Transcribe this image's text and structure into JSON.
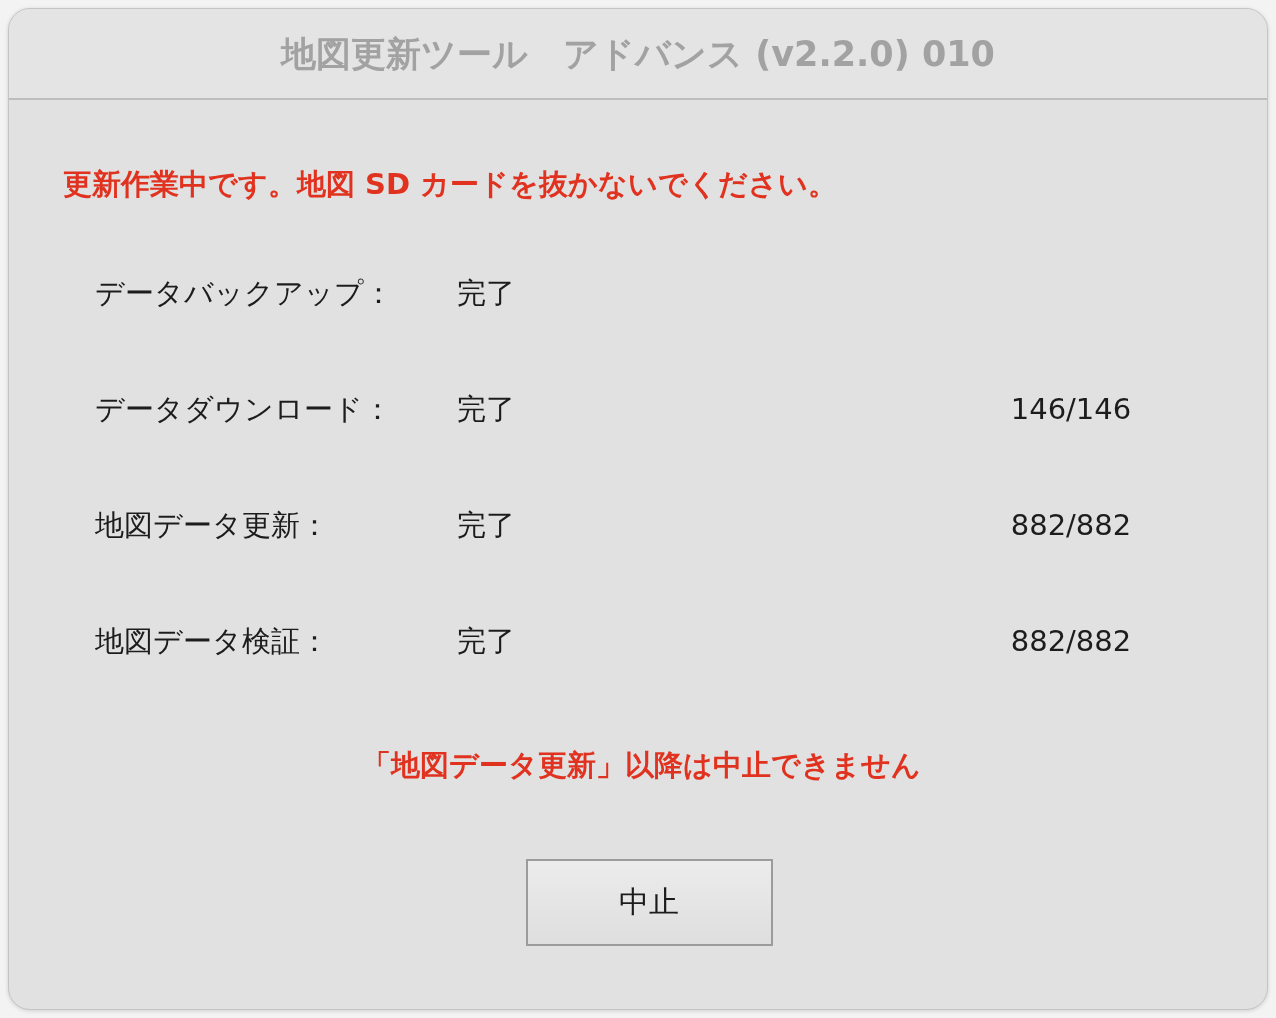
{
  "window": {
    "title": "地図更新ツール　アドバンス (v2.2.0) 010"
  },
  "warning": "更新作業中です。地図 SD カードを抜かないでください。",
  "steps": [
    {
      "label": "データバックアップ：",
      "status": "完了"
    },
    {
      "label": "データダウンロード：",
      "status": "完了",
      "count": "146/146"
    },
    {
      "label": "地図データ更新：",
      "status": "完了",
      "count": "882/882"
    },
    {
      "label": "地図データ検証：",
      "status": "完了",
      "count": "882/882"
    }
  ],
  "note": "「地図データ更新」以降は中止できません",
  "buttons": [
    {
      "label": "中止"
    }
  ]
}
